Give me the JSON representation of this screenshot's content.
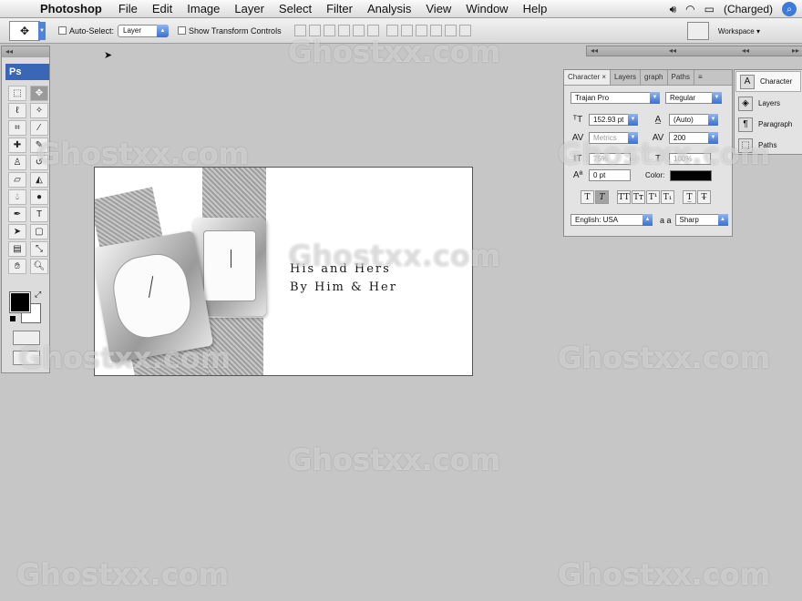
{
  "menubar": {
    "app": "Photoshop",
    "items": [
      "File",
      "Edit",
      "Image",
      "Layer",
      "Select",
      "Filter",
      "Analysis",
      "View",
      "Window",
      "Help"
    ],
    "battery": "(Charged)"
  },
  "options": {
    "auto_select": "Auto-Select:",
    "auto_select_value": "Layer",
    "show_transform": "Show Transform Controls",
    "workspace": "Workspace ▾"
  },
  "toolbox": {
    "logo": "Ps"
  },
  "canvas": {
    "line1": "His and Hers",
    "line2": "By Him & Her"
  },
  "character": {
    "tabs": [
      "Character",
      "Layers",
      "graph",
      "Paths"
    ],
    "font_family": "Trajan Pro",
    "font_style": "Regular",
    "size": "152.93 pt",
    "leading": "(Auto)",
    "kerning": "Metrics",
    "tracking": "200",
    "vscale": "75%",
    "hscale": "100%",
    "baseline": "0 pt",
    "color_label": "Color:",
    "language": "English: USA",
    "aa_label": "a a",
    "antialias": "Sharp",
    "color": "#000000"
  },
  "dock": {
    "items": [
      "Character",
      "Layers",
      "Paragraph",
      "Paths"
    ]
  },
  "watermark": "Ghostxx.com"
}
